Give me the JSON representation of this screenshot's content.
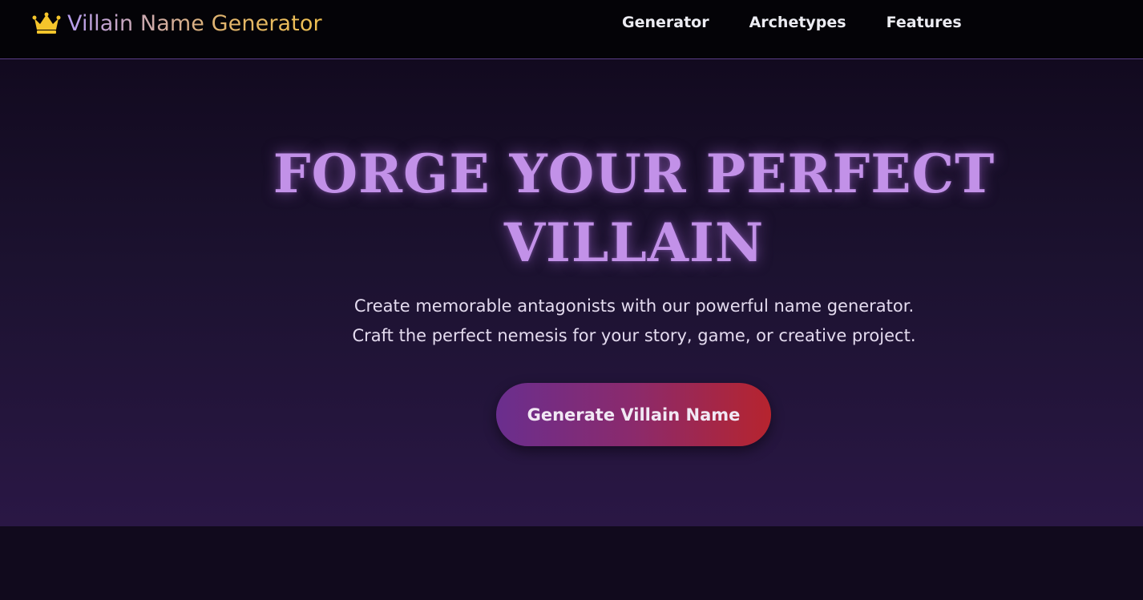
{
  "header": {
    "brand_icon": "crown-icon",
    "brand_title": "Villain Name Generator",
    "nav": [
      {
        "label": "Generator"
      },
      {
        "label": "Archetypes"
      },
      {
        "label": "Features"
      }
    ]
  },
  "hero": {
    "title_line1": "FORGE YOUR PERFECT",
    "title_line2": "VILLAIN",
    "subtitle_line1": "Create memorable antagonists with our powerful name generator.",
    "subtitle_line2": "Craft the perfect nemesis for your story, game, or creative project.",
    "cta_label": "Generate Villain Name"
  },
  "colors": {
    "background": "#110a1d",
    "navbar": "#040307",
    "title": "#c291e8",
    "crown": "#f5c52b",
    "cta_start": "#6a2e8e",
    "cta_end": "#b6242e"
  }
}
